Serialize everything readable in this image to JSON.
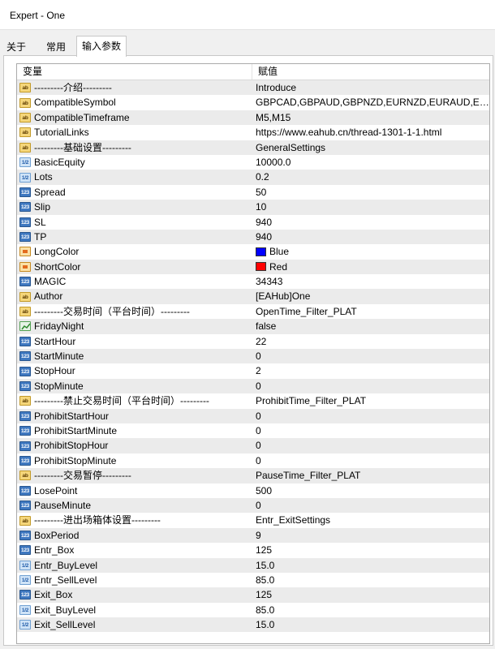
{
  "window": {
    "title": "Expert - One"
  },
  "tabs": [
    {
      "label": "关于",
      "active": false
    },
    {
      "label": "常用",
      "active": false
    },
    {
      "label": "输入参数",
      "active": true
    }
  ],
  "grid": {
    "columns": {
      "variable": "变量",
      "value": "赋值"
    },
    "rows": [
      {
        "icon": "ab",
        "name": "---------介绍---------",
        "value": "Introduce"
      },
      {
        "icon": "ab",
        "name": "CompatibleSymbol",
        "value": "GBPCAD,GBPAUD,GBPNZD,EURNZD,EURAUD,EURCAD..."
      },
      {
        "icon": "ab",
        "name": "CompatibleTimeframe",
        "value": "M5,M15"
      },
      {
        "icon": "ab",
        "name": "TutorialLinks",
        "value": "https://www.eahub.cn/thread-1301-1-1.html"
      },
      {
        "icon": "ab",
        "name": "---------基础设置---------",
        "value": "GeneralSettings"
      },
      {
        "icon": "v12",
        "name": "BasicEquity",
        "value": "10000.0"
      },
      {
        "icon": "v12",
        "name": "Lots",
        "value": "0.2"
      },
      {
        "icon": "n123",
        "name": "Spread",
        "value": "50"
      },
      {
        "icon": "n123",
        "name": "Slip",
        "value": "10"
      },
      {
        "icon": "n123",
        "name": "SL",
        "value": "940"
      },
      {
        "icon": "n123",
        "name": "TP",
        "value": "940"
      },
      {
        "icon": "color",
        "name": "LongColor",
        "value": "Blue",
        "swatch": "#0000ff"
      },
      {
        "icon": "color",
        "name": "ShortColor",
        "value": "Red",
        "swatch": "#ff0000"
      },
      {
        "icon": "n123",
        "name": "MAGIC",
        "value": "34343"
      },
      {
        "icon": "ab",
        "name": "Author",
        "value": "[EAHub]One"
      },
      {
        "icon": "ab",
        "name": "---------交易时间（平台时间）---------",
        "value": "OpenTime_Filter_PLAT"
      },
      {
        "icon": "bool",
        "name": "FridayNight",
        "value": "false"
      },
      {
        "icon": "n123",
        "name": "StartHour",
        "value": "22"
      },
      {
        "icon": "n123",
        "name": "StartMinute",
        "value": "0"
      },
      {
        "icon": "n123",
        "name": "StopHour",
        "value": "2"
      },
      {
        "icon": "n123",
        "name": "StopMinute",
        "value": "0"
      },
      {
        "icon": "ab",
        "name": "---------禁止交易时间（平台时间）---------",
        "value": "ProhibitTime_Filter_PLAT"
      },
      {
        "icon": "n123",
        "name": "ProhibitStartHour",
        "value": "0"
      },
      {
        "icon": "n123",
        "name": "ProhibitStartMinute",
        "value": "0"
      },
      {
        "icon": "n123",
        "name": "ProhibitStopHour",
        "value": "0"
      },
      {
        "icon": "n123",
        "name": "ProhibitStopMinute",
        "value": "0"
      },
      {
        "icon": "ab",
        "name": "---------交易暂停---------",
        "value": "PauseTime_Filter_PLAT"
      },
      {
        "icon": "n123",
        "name": "LosePoint",
        "value": "500"
      },
      {
        "icon": "n123",
        "name": "PauseMinute",
        "value": "0"
      },
      {
        "icon": "ab",
        "name": "---------进出场箱体设置---------",
        "value": "Entr_ExitSettings"
      },
      {
        "icon": "n123",
        "name": "BoxPeriod",
        "value": "9"
      },
      {
        "icon": "n123",
        "name": "Entr_Box",
        "value": "125"
      },
      {
        "icon": "v12",
        "name": "Entr_BuyLevel",
        "value": "15.0"
      },
      {
        "icon": "v12",
        "name": "Entr_SellLevel",
        "value": "85.0"
      },
      {
        "icon": "n123",
        "name": "Exit_Box",
        "value": "125"
      },
      {
        "icon": "v12",
        "name": "Exit_BuyLevel",
        "value": "85.0"
      },
      {
        "icon": "v12",
        "name": "Exit_SellLevel",
        "value": "15.0"
      }
    ]
  },
  "icons": {
    "ab": "string-type-icon",
    "n123": "integer-type-icon",
    "v12": "double-type-icon",
    "color": "color-type-icon",
    "bool": "bool-type-icon"
  }
}
